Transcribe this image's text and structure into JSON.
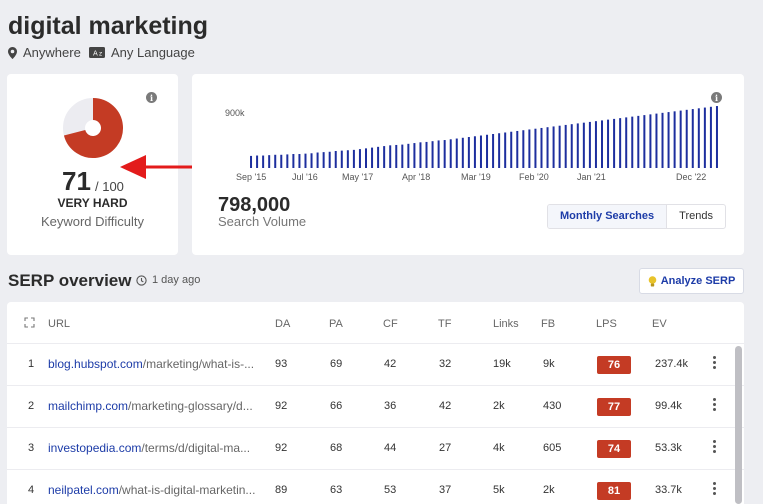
{
  "header": {
    "keyword": "digital marketing",
    "location": "Anywhere",
    "language": "Any Language",
    "location_icon": "map-pin-icon",
    "language_icon": "translate-icon"
  },
  "difficulty": {
    "value": "71",
    "max": "/ 100",
    "level": "VERY HARD",
    "label": "Keyword Difficulty",
    "score_fraction": 0.71,
    "color": "#c43b24"
  },
  "volume": {
    "value": "798,000",
    "label": "Search Volume",
    "tabs": [
      "Monthly Searches",
      "Trends"
    ],
    "active_tab": "Monthly Searches"
  },
  "chart_data": {
    "type": "bar",
    "y_tick_label": "900k",
    "x_tick_labels": [
      "Sep '15",
      "Jul '16",
      "May '17",
      "Apr '18",
      "Mar '19",
      "Feb '20",
      "Jan '21",
      "Dec '22"
    ],
    "ylim": [
      0,
      900000
    ],
    "color": "#1d2e9e",
    "values": [
      160000,
      165000,
      165000,
      170000,
      175000,
      175000,
      180000,
      185000,
      185000,
      190000,
      195000,
      205000,
      210000,
      215000,
      225000,
      230000,
      235000,
      240000,
      250000,
      260000,
      270000,
      280000,
      290000,
      300000,
      305000,
      310000,
      320000,
      330000,
      340000,
      345000,
      355000,
      365000,
      370000,
      380000,
      390000,
      400000,
      410000,
      420000,
      430000,
      440000,
      450000,
      460000,
      470000,
      480000,
      490000,
      500000,
      510000,
      520000,
      530000,
      540000,
      550000,
      560000,
      570000,
      580000,
      590000,
      600000,
      610000,
      620000,
      630000,
      640000,
      650000,
      660000,
      670000,
      680000,
      690000,
      700000,
      710000,
      720000,
      730000,
      740000,
      750000,
      760000,
      770000,
      780000,
      790000,
      800000,
      810000,
      820000
    ]
  },
  "serp": {
    "title": "SERP overview",
    "updated": "1 day ago",
    "analyze_label": "Analyze SERP",
    "columns": [
      "URL",
      "DA",
      "PA",
      "CF",
      "TF",
      "Links",
      "FB",
      "LPS",
      "EV"
    ],
    "rows": [
      {
        "rank": "1",
        "domain": "blog.hubspot.com",
        "path": "/marketing/what-is-...",
        "da": "93",
        "pa": "69",
        "cf": "42",
        "tf": "32",
        "links": "19k",
        "fb": "9k",
        "lps": "76",
        "ev": "237.4k"
      },
      {
        "rank": "2",
        "domain": "mailchimp.com",
        "path": "/marketing-glossary/d...",
        "da": "92",
        "pa": "66",
        "cf": "36",
        "tf": "42",
        "links": "2k",
        "fb": "430",
        "lps": "77",
        "ev": "99.4k"
      },
      {
        "rank": "3",
        "domain": "investopedia.com",
        "path": "/terms/d/digital-ma...",
        "da": "92",
        "pa": "68",
        "cf": "44",
        "tf": "27",
        "links": "4k",
        "fb": "605",
        "lps": "74",
        "ev": "53.3k"
      },
      {
        "rank": "4",
        "domain": "neilpatel.com",
        "path": "/what-is-digital-marketin...",
        "da": "89",
        "pa": "63",
        "cf": "53",
        "tf": "37",
        "links": "5k",
        "fb": "2k",
        "lps": "81",
        "ev": "33.7k"
      }
    ]
  }
}
